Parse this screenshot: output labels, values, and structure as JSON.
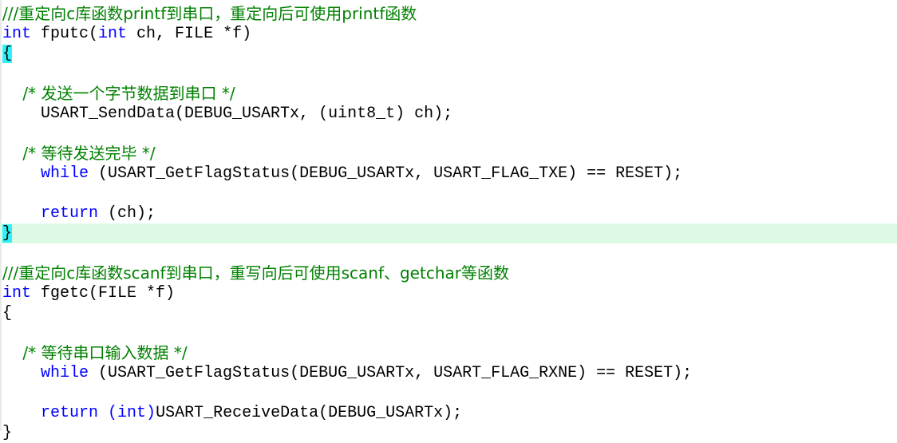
{
  "editor": {
    "language": "C",
    "colors": {
      "background": "#ffffff",
      "keyword": "#0000ff",
      "comment": "#008000",
      "plain": "#000000",
      "current_line_highlight": "#ddfbe4",
      "matching_brace_highlight": "#2ff1f7"
    }
  },
  "code": {
    "lines": [
      {
        "id": "line-1",
        "kind": "comment",
        "text": "///重定向c库函数printf到串口，重定向后可使用printf函数"
      },
      {
        "id": "line-2",
        "kind": "code",
        "text": "int fputc(int ch, FILE *f)",
        "keyword_1": "int",
        "name": " fputc(",
        "keyword_2": "int",
        "tail": " ch, FILE *f)"
      },
      {
        "id": "line-3",
        "kind": "brace-open",
        "text": "{"
      },
      {
        "id": "line-4",
        "kind": "blank",
        "text": ""
      },
      {
        "id": "line-5",
        "kind": "comment",
        "text": "    /* 发送一个字节数据到串口 */"
      },
      {
        "id": "line-6",
        "kind": "code",
        "text": "    USART_SendData(DEBUG_USARTx, (uint8_t) ch);"
      },
      {
        "id": "line-7",
        "kind": "blank",
        "text": ""
      },
      {
        "id": "line-8",
        "kind": "comment",
        "text": "    /* 等待发送完毕 */"
      },
      {
        "id": "line-9",
        "kind": "code",
        "keyword": "while",
        "tail": " (USART_GetFlagStatus(DEBUG_USARTx, USART_FLAG_TXE) == RESET);",
        "text": "    while (USART_GetFlagStatus(DEBUG_USARTx, USART_FLAG_TXE) == RESET);"
      },
      {
        "id": "line-10",
        "kind": "blank",
        "text": ""
      },
      {
        "id": "line-11",
        "kind": "code",
        "keyword": "return",
        "tail": " (ch);",
        "text": "    return (ch);"
      },
      {
        "id": "line-12",
        "kind": "brace-close-current",
        "text": "}"
      },
      {
        "id": "line-13",
        "kind": "blank",
        "text": ""
      },
      {
        "id": "line-14",
        "kind": "comment",
        "text": "///重定向c库函数scanf到串口，重写向后可使用scanf、getchar等函数"
      },
      {
        "id": "line-15",
        "kind": "code",
        "text": "int fgetc(FILE *f)",
        "keyword_1": "int",
        "tail": " fgetc(FILE *f)"
      },
      {
        "id": "line-16",
        "kind": "brace-open-plain",
        "text": "{"
      },
      {
        "id": "line-17",
        "kind": "blank",
        "text": ""
      },
      {
        "id": "line-18",
        "kind": "comment",
        "text": "    /* 等待串口输入数据 */"
      },
      {
        "id": "line-19",
        "kind": "code",
        "keyword": "while",
        "tail": " (USART_GetFlagStatus(DEBUG_USARTx, USART_FLAG_RXNE) == RESET);",
        "text": "    while (USART_GetFlagStatus(DEBUG_USARTx, USART_FLAG_RXNE) == RESET);"
      },
      {
        "id": "line-20",
        "kind": "blank",
        "text": ""
      },
      {
        "id": "line-21",
        "kind": "code",
        "keyword": "return",
        "cast": "(int)",
        "tail": "USART_ReceiveData(DEBUG_USARTx);",
        "text": "    return (int)USART_ReceiveData(DEBUG_USARTx);"
      },
      {
        "id": "line-22",
        "kind": "brace-close-plain",
        "text": "}"
      }
    ],
    "tokens": {
      "l1_comment": "///重定向c库函数printf到串口，重定向后可使用printf函数",
      "l2_kw_int_a": "int",
      "l2_fn": " fputc(",
      "l2_kw_int_b": "int",
      "l2_rest": " ch, FILE *f)",
      "l3_brace": "{",
      "l5_comment": "    /* 发送一个字节数据到串口 */",
      "l6_code": "    USART_SendData(DEBUG_USARTx, (uint8_t) ch);",
      "l8_comment": "    /* 等待发送完毕 */",
      "l9_indent": "    ",
      "l9_kw": "while",
      "l9_rest": " (USART_GetFlagStatus(DEBUG_USARTx, USART_FLAG_TXE) == RESET);",
      "l11_indent": "    ",
      "l11_kw": "return",
      "l11_rest": " (ch);",
      "l12_brace": "}",
      "l14_comment": "///重定向c库函数scanf到串口，重写向后可使用scanf、getchar等函数",
      "l15_kw_int": "int",
      "l15_rest": " fgetc(FILE *f)",
      "l16_brace": "{",
      "l18_comment": "    /* 等待串口输入数据 */",
      "l19_indent": "    ",
      "l19_kw": "while",
      "l19_rest": " (USART_GetFlagStatus(DEBUG_USARTx, USART_FLAG_RXNE) == RESET);",
      "l21_indent": "    ",
      "l21_kw": "return",
      "l21_space": " ",
      "l21_cast": "(int)",
      "l21_rest": "USART_ReceiveData(DEBUG_USARTx);",
      "l22_brace": "}"
    }
  }
}
